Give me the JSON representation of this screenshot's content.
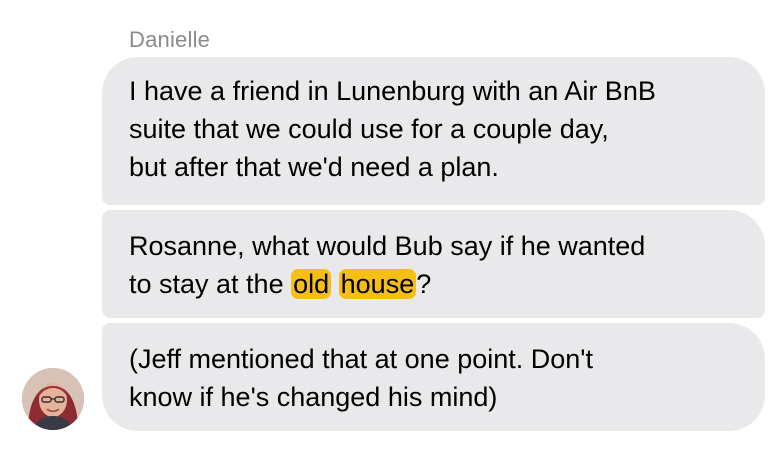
{
  "conversation": {
    "sender_name": "Danielle",
    "messages": [
      {
        "lines": [
          "I have a friend in Lunenburg with an Air BnB",
          "suite that we could use for a couple day,",
          "but after that we'd need a plan."
        ]
      },
      {
        "line1": "Rosanne, what would Bub say if he wanted",
        "line2_prefix": "to stay at the ",
        "highlight_1": "old",
        "highlight_2": "house",
        "line2_suffix": "?"
      },
      {
        "lines": [
          "(Jeff mentioned that at one point. Don't",
          "know if he's changed his mind)"
        ]
      }
    ],
    "avatar": "sender-avatar-photo"
  },
  "colors": {
    "bubble_background": "#e9e9eb",
    "highlight": "#f6bf17",
    "sender_name": "#8a8a8e",
    "text": "#000000"
  }
}
